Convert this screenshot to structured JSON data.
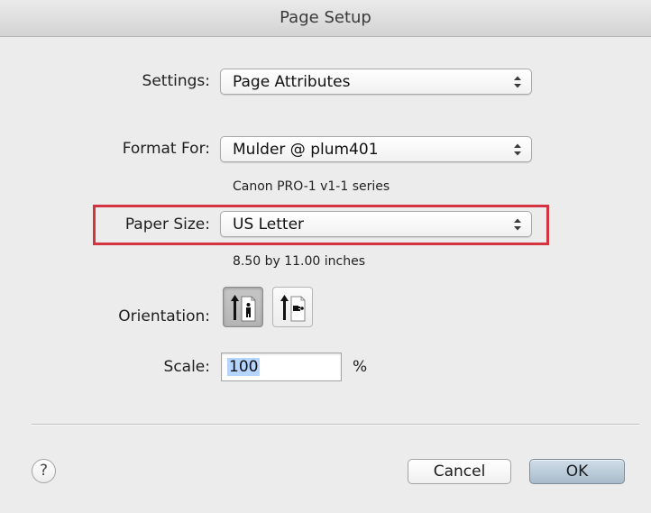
{
  "window": {
    "title": "Page Setup"
  },
  "settings": {
    "label": "Settings:",
    "value": "Page Attributes"
  },
  "format_for": {
    "label": "Format For:",
    "value": "Mulder @ plum401",
    "info": "Canon PRO-1 v1-1 series"
  },
  "paper_size": {
    "label": "Paper Size:",
    "value": "US Letter",
    "info": "8.50 by 11.00 inches"
  },
  "orientation": {
    "label": "Orientation:",
    "options": [
      {
        "name": "portrait",
        "selected": true
      },
      {
        "name": "landscape",
        "selected": false
      }
    ]
  },
  "scale": {
    "label": "Scale:",
    "value": "100",
    "unit": "%"
  },
  "buttons": {
    "help": "?",
    "cancel": "Cancel",
    "ok": "OK"
  },
  "colors": {
    "highlight": "#d4343f",
    "default_button": "#a9bccb",
    "selection": "#b5d5ff"
  },
  "icons": [
    "up-down-arrows-icon",
    "portrait-orientation-icon",
    "landscape-orientation-icon",
    "help-icon"
  ]
}
